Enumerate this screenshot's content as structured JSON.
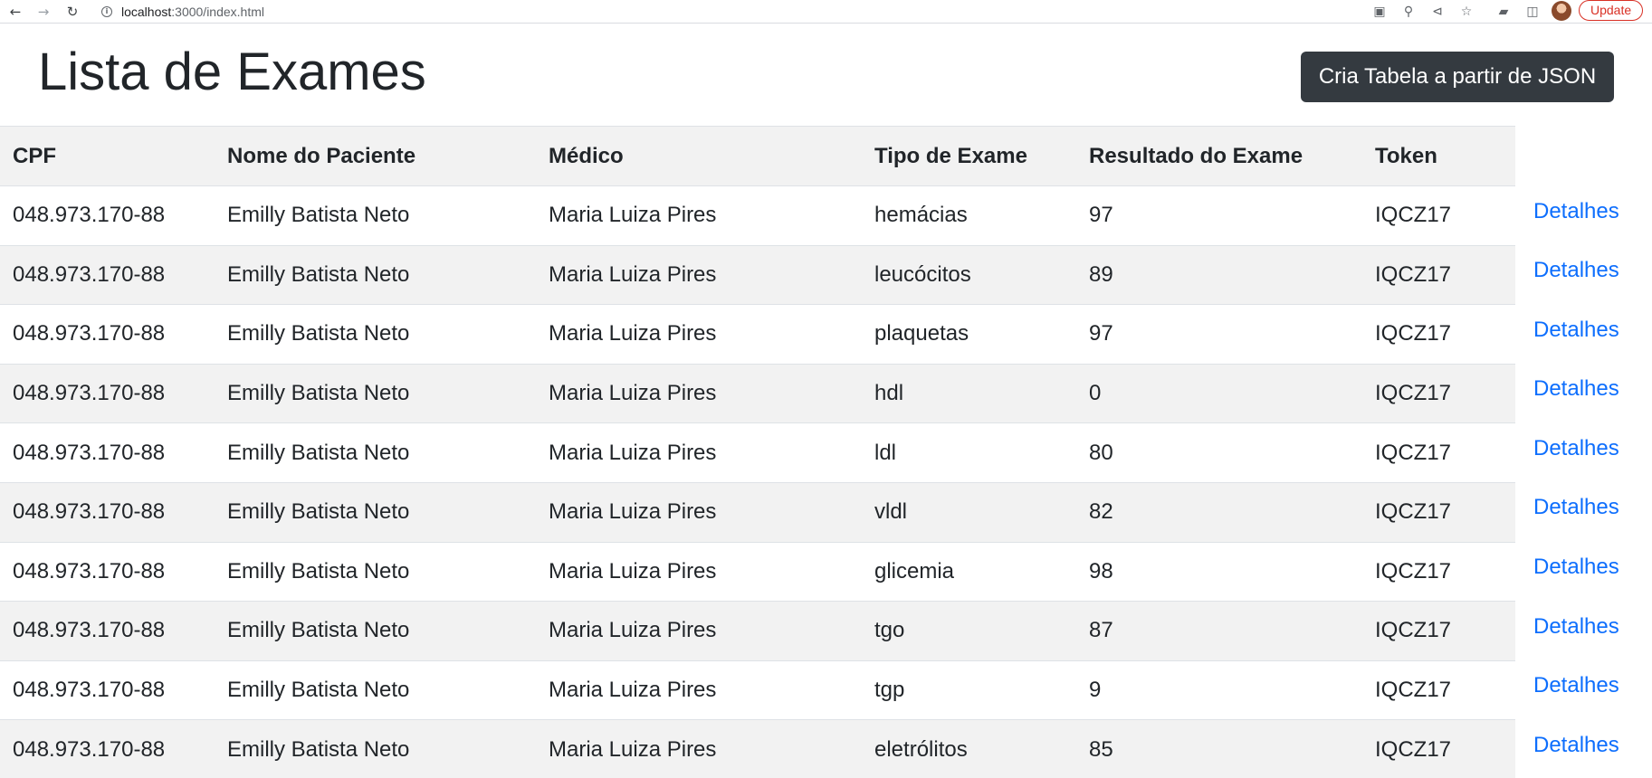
{
  "browser": {
    "url_host": "localhost",
    "url_path": ":3000/index.html",
    "update_label": "Update"
  },
  "page": {
    "title": "Lista de Exames",
    "json_button_label": "Cria Tabela a partir de JSON"
  },
  "table": {
    "headers": [
      "CPF",
      "Nome do Paciente",
      "Médico",
      "Tipo de Exame",
      "Resultado do Exame",
      "Token"
    ],
    "link_label": "Detalhes",
    "rows": [
      {
        "cpf": "048.973.170-88",
        "paciente": "Emilly Batista Neto",
        "medico": "Maria Luiza Pires",
        "tipo": "hemácias",
        "resultado": "97",
        "token": "IQCZ17"
      },
      {
        "cpf": "048.973.170-88",
        "paciente": "Emilly Batista Neto",
        "medico": "Maria Luiza Pires",
        "tipo": "leucócitos",
        "resultado": "89",
        "token": "IQCZ17"
      },
      {
        "cpf": "048.973.170-88",
        "paciente": "Emilly Batista Neto",
        "medico": "Maria Luiza Pires",
        "tipo": "plaquetas",
        "resultado": "97",
        "token": "IQCZ17"
      },
      {
        "cpf": "048.973.170-88",
        "paciente": "Emilly Batista Neto",
        "medico": "Maria Luiza Pires",
        "tipo": "hdl",
        "resultado": "0",
        "token": "IQCZ17"
      },
      {
        "cpf": "048.973.170-88",
        "paciente": "Emilly Batista Neto",
        "medico": "Maria Luiza Pires",
        "tipo": "ldl",
        "resultado": "80",
        "token": "IQCZ17"
      },
      {
        "cpf": "048.973.170-88",
        "paciente": "Emilly Batista Neto",
        "medico": "Maria Luiza Pires",
        "tipo": "vldl",
        "resultado": "82",
        "token": "IQCZ17"
      },
      {
        "cpf": "048.973.170-88",
        "paciente": "Emilly Batista Neto",
        "medico": "Maria Luiza Pires",
        "tipo": "glicemia",
        "resultado": "98",
        "token": "IQCZ17"
      },
      {
        "cpf": "048.973.170-88",
        "paciente": "Emilly Batista Neto",
        "medico": "Maria Luiza Pires",
        "tipo": "tgo",
        "resultado": "87",
        "token": "IQCZ17"
      },
      {
        "cpf": "048.973.170-88",
        "paciente": "Emilly Batista Neto",
        "medico": "Maria Luiza Pires",
        "tipo": "tgp",
        "resultado": "9",
        "token": "IQCZ17"
      },
      {
        "cpf": "048.973.170-88",
        "paciente": "Emilly Batista Neto",
        "medico": "Maria Luiza Pires",
        "tipo": "eletrólitos",
        "resultado": "85",
        "token": "IQCZ17"
      }
    ]
  },
  "colors": {
    "button_bg": "#343a40",
    "link": "#0d6efd",
    "stripe": "#f2f2f2",
    "update_red": "#d93025"
  },
  "icons": [
    "back-arrow-icon",
    "forward-arrow-icon",
    "reload-icon",
    "site-info-icon",
    "translate-icon",
    "zoom-icon",
    "share-icon",
    "bookmark-star-icon",
    "extensions-icon",
    "side-panel-icon",
    "profile-avatar"
  ]
}
